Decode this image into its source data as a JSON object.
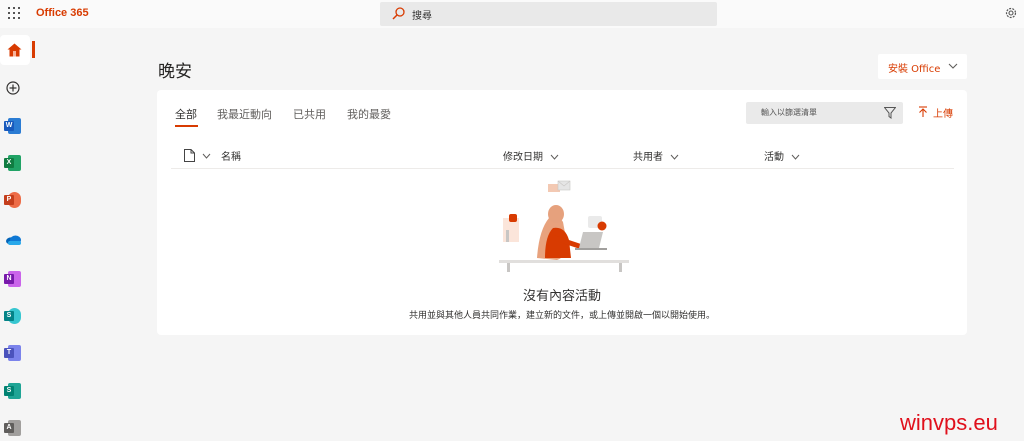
{
  "app": {
    "title": "Office 365"
  },
  "search": {
    "placeholder": "搜尋"
  },
  "page": {
    "greeting": "晚安",
    "install_label": "安裝 Office"
  },
  "tabs": [
    {
      "label": "全部",
      "active": true
    },
    {
      "label": "我最近動向",
      "active": false
    },
    {
      "label": "已共用",
      "active": false
    },
    {
      "label": "我的最愛",
      "active": false
    }
  ],
  "filter": {
    "placeholder": "輸入以篩選清單"
  },
  "upload": {
    "label": "上傳"
  },
  "columns": {
    "name": "名稱",
    "modified": "修改日期",
    "shared_by": "共用者",
    "activity": "活動"
  },
  "empty_state": {
    "title": "沒有內容活動",
    "subtitle": "共用並與其他人員共同作業，建立新的文件，或上傳並開啟一個以開始使用。"
  },
  "rail": {
    "items": [
      {
        "name": "home",
        "color": "#d83b01"
      },
      {
        "name": "create",
        "color": "#323130"
      },
      {
        "name": "word",
        "letter": "W",
        "color": "#185abd"
      },
      {
        "name": "excel",
        "letter": "X",
        "color": "#107c41"
      },
      {
        "name": "powerpoint",
        "letter": "P",
        "color": "#c43e1c"
      },
      {
        "name": "onedrive",
        "color": "#0364b8"
      },
      {
        "name": "onenote",
        "letter": "N",
        "color": "#7719aa"
      },
      {
        "name": "sharepoint",
        "letter": "S",
        "color": "#038387"
      },
      {
        "name": "teams",
        "letter": "T",
        "color": "#4b53bc"
      },
      {
        "name": "sway",
        "letter": "S",
        "color": "#008272"
      },
      {
        "name": "admin",
        "letter": "A",
        "color": "#605e5c"
      }
    ]
  },
  "watermark": "winvps.eu",
  "colors": {
    "accent": "#d83b01",
    "background": "#f5f5f5",
    "card": "#ffffff"
  }
}
